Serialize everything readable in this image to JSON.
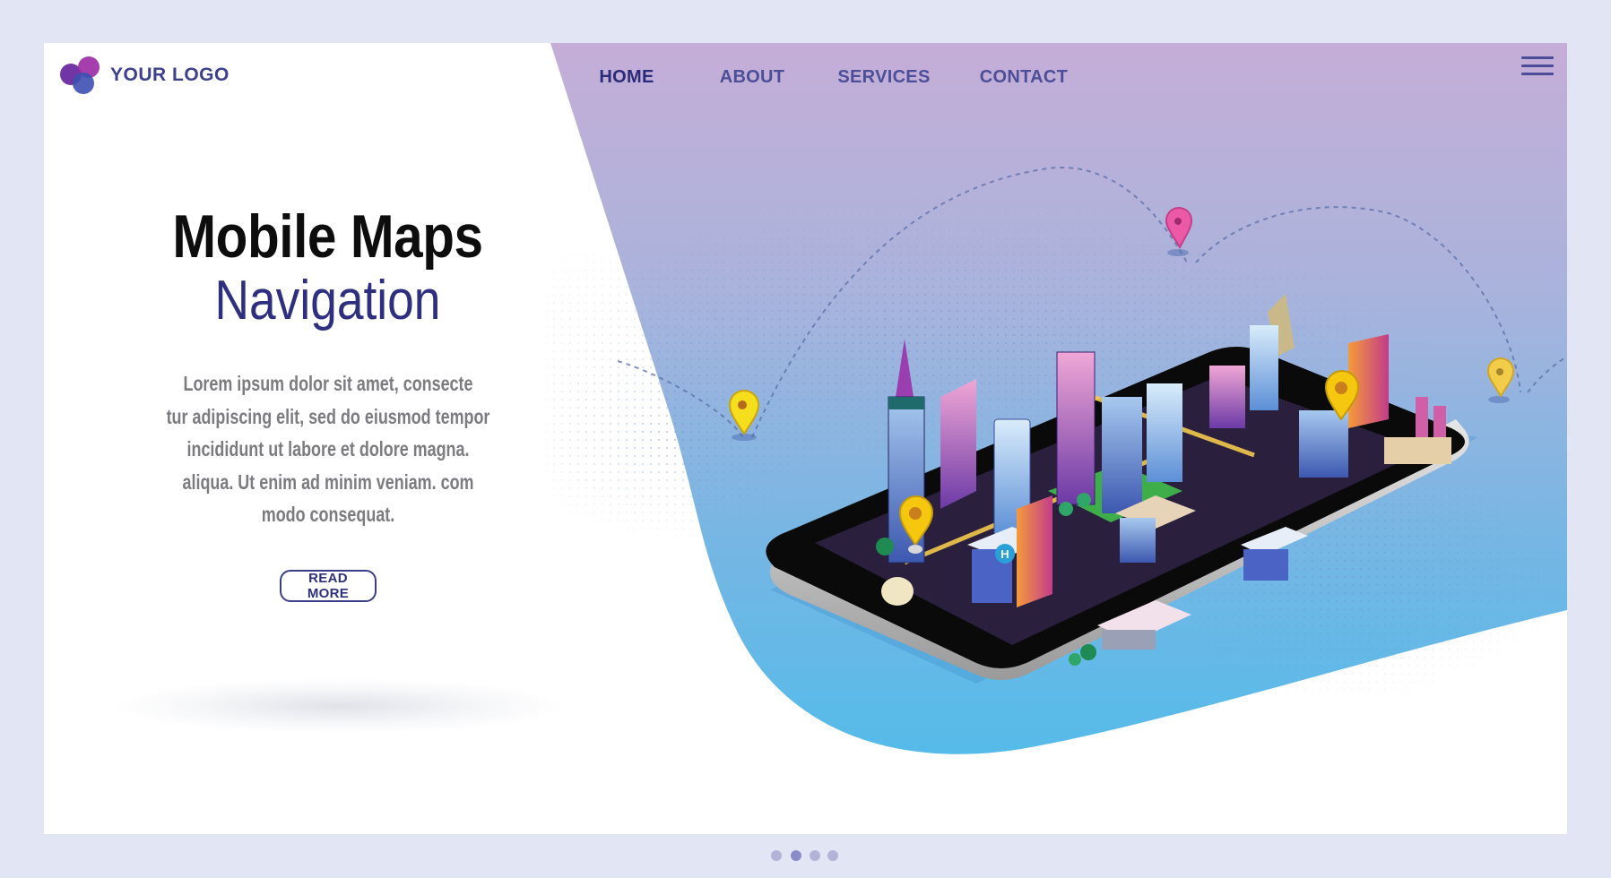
{
  "logo": {
    "text": "YOUR LOGO",
    "icon": "three-circles-logo-icon"
  },
  "nav": {
    "items": [
      {
        "label": "HOME",
        "active": true
      },
      {
        "label": "ABOUT",
        "active": false
      },
      {
        "label": "SERVICES",
        "active": false
      },
      {
        "label": "CONTACT",
        "active": false
      }
    ],
    "menu_icon": "hamburger-menu-icon"
  },
  "hero": {
    "title": "Mobile Maps",
    "subtitle": "Navigation",
    "paragraph_lines": [
      "Lorem ipsum dolor sit amet, consecte",
      "tur adipiscing elit, sed do eiusmod tempor",
      "incididunt ut labore et dolore magna.",
      "aliqua. Ut enim ad minim veniam. com",
      "modo consequat."
    ],
    "button_label": "READ MORE"
  },
  "illustration": {
    "subject": "isometric city on smartphone with map pins",
    "pins": [
      "yellow-pin",
      "pink-pin",
      "yellow-pin",
      "yellow-pin",
      "yellow-pin"
    ],
    "hospital_badge": "H"
  },
  "pagination": {
    "count": 4,
    "active_index": 1
  },
  "colors": {
    "page_bg": "#e2e6f4",
    "accent_dark": "#2e2f7f",
    "nav_text": "#4c4f98",
    "gradient_top": "#c4aed6",
    "gradient_bottom": "#58b9e8",
    "body_text": "#7b7b80"
  }
}
